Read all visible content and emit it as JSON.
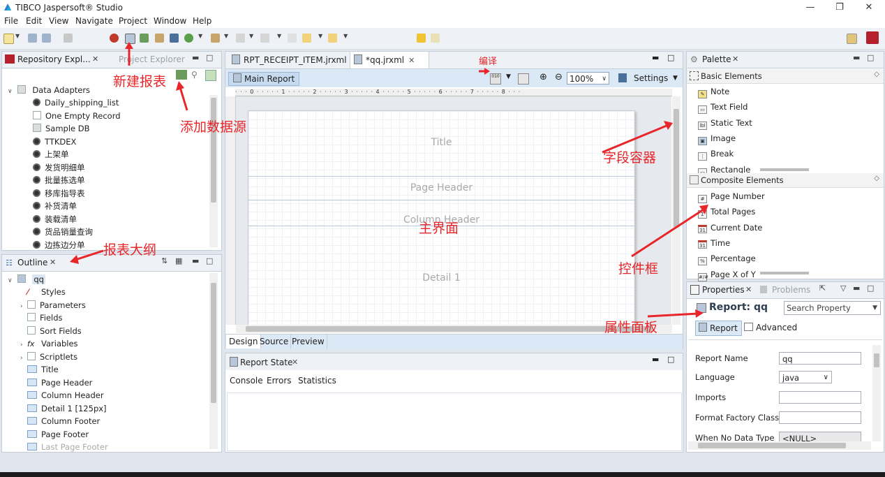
{
  "window": {
    "title": "TIBCO Jaspersoft® Studio",
    "minimize": "—",
    "restore": "❐",
    "close": "✕"
  },
  "menu": [
    "File",
    "Edit",
    "View",
    "Navigate",
    "Project",
    "Window",
    "Help"
  ],
  "repository": {
    "tab_label": "Repository Expl...",
    "other_tab": "Project Explorer",
    "root": "Data Adapters",
    "items": [
      "Daily_shipping_list",
      "One Empty Record",
      "Sample DB",
      "TTKDEX",
      "上架单",
      "发货明细单",
      "批量拣选单",
      "移库指导表",
      "补货清单",
      "装载清单",
      "货品销量查询",
      "边拣边分单"
    ]
  },
  "outline": {
    "tab_label": "Outline",
    "root": "qq",
    "items": [
      "Styles",
      "Parameters",
      "Fields",
      "Sort Fields",
      "Variables",
      "Scriptlets",
      "Title",
      "Page Header",
      "Column Header",
      "Detail 1 [125px]",
      "Column Footer",
      "Page Footer",
      "Last Page Footer"
    ]
  },
  "editor": {
    "tabs": [
      "RPT_RECEIPT_ITEM.jrxml",
      "*qq.jrxml"
    ],
    "main_report": "Main Report",
    "zoom": "100%",
    "settings": "Settings",
    "bands": [
      "Title",
      "Page Header",
      "Column Header",
      "Detail 1"
    ],
    "bottom_tabs": [
      "Design",
      "Source",
      "Preview"
    ]
  },
  "report_state": {
    "tab_label": "Report State",
    "tabs": [
      "Console",
      "Errors",
      "Statistics"
    ]
  },
  "palette": {
    "tab_label": "Palette",
    "basic_header": "Basic Elements",
    "basic": [
      "Note",
      "Text Field",
      "Static Text",
      "Image",
      "Break",
      "Rectangle"
    ],
    "composite_header": "Composite Elements",
    "composite": [
      "Page Number",
      "Total Pages",
      "Current Date",
      "Time",
      "Percentage",
      "Page X of Y"
    ]
  },
  "properties": {
    "tab_label": "Properties",
    "problems_tab": "Problems",
    "heading": "Report: qq",
    "search_placeholder": "Search Property",
    "subtabs": [
      "Report",
      "Advanced"
    ],
    "rows": [
      {
        "label": "Report Name",
        "value": "qq"
      },
      {
        "label": "Language",
        "value": "java"
      },
      {
        "label": "Imports",
        "value": ""
      },
      {
        "label": "Format Factory Class",
        "value": ""
      },
      {
        "label": "When No Data Type",
        "value": "<NULL>"
      }
    ]
  },
  "annotations": {
    "new_report": "新建报表",
    "add_datasource": "添加数据源",
    "compile": "编译",
    "outline": "报表大纲",
    "main_ui": "主界面",
    "field_container": "字段容器",
    "control_box": "控件框",
    "properties_panel": "属性面板"
  },
  "colors": {
    "annotation": "#e8262a",
    "accent": "#d7e6f5"
  }
}
